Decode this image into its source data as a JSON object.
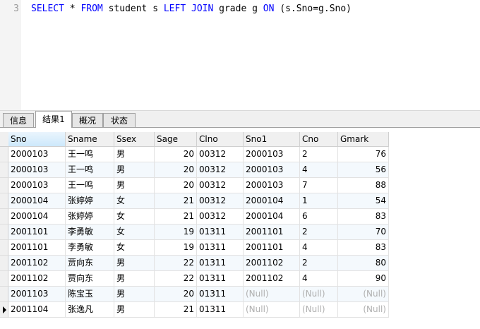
{
  "editor": {
    "line_number": "3",
    "sql": [
      {
        "text": "SELECT",
        "kw": true
      },
      {
        "text": " * ",
        "kw": false
      },
      {
        "text": "FROM",
        "kw": true
      },
      {
        "text": " student s ",
        "kw": false
      },
      {
        "text": "LEFT JOIN",
        "kw": true
      },
      {
        "text": " grade g ",
        "kw": false
      },
      {
        "text": "ON",
        "kw": true
      },
      {
        "text": " (s.Sno=g.Sno)",
        "kw": false
      }
    ]
  },
  "tabs": [
    {
      "label": "信息",
      "active": false
    },
    {
      "label": "结果1",
      "active": true
    },
    {
      "label": "概况",
      "active": false
    },
    {
      "label": "状态",
      "active": false
    }
  ],
  "grid": {
    "columns": [
      {
        "name": "Sno",
        "align": "left",
        "sorted": true
      },
      {
        "name": "Sname",
        "align": "left"
      },
      {
        "name": "Ssex",
        "align": "left"
      },
      {
        "name": "Sage",
        "align": "right"
      },
      {
        "name": "Clno",
        "align": "left"
      },
      {
        "name": "Sno1",
        "align": "left"
      },
      {
        "name": "Cno",
        "align": "left"
      },
      {
        "name": "Gmark",
        "align": "right"
      }
    ],
    "null_text": "(Null)",
    "current_row": 10,
    "rows": [
      [
        "2000103",
        "王一鸣",
        "男",
        "20",
        "00312",
        "2000103",
        "2",
        "76"
      ],
      [
        "2000103",
        "王一鸣",
        "男",
        "20",
        "00312",
        "2000103",
        "4",
        "56"
      ],
      [
        "2000103",
        "王一鸣",
        "男",
        "20",
        "00312",
        "2000103",
        "7",
        "88"
      ],
      [
        "2000104",
        "张婷婷",
        "女",
        "21",
        "00312",
        "2000104",
        "1",
        "54"
      ],
      [
        "2000104",
        "张婷婷",
        "女",
        "21",
        "00312",
        "2000104",
        "6",
        "83"
      ],
      [
        "2001101",
        "李勇敏",
        "女",
        "19",
        "01311",
        "2001101",
        "2",
        "70"
      ],
      [
        "2001101",
        "李勇敏",
        "女",
        "19",
        "01311",
        "2001101",
        "4",
        "83"
      ],
      [
        "2001102",
        "贾向东",
        "男",
        "22",
        "01311",
        "2001102",
        "2",
        "80"
      ],
      [
        "2001102",
        "贾向东",
        "男",
        "22",
        "01311",
        "2001102",
        "4",
        "90"
      ],
      [
        "2001103",
        "陈宝玉",
        "男",
        "20",
        "01311",
        null,
        null,
        null
      ],
      [
        "2001104",
        "张逸凡",
        "男",
        "21",
        "01311",
        null,
        null,
        null
      ]
    ]
  }
}
